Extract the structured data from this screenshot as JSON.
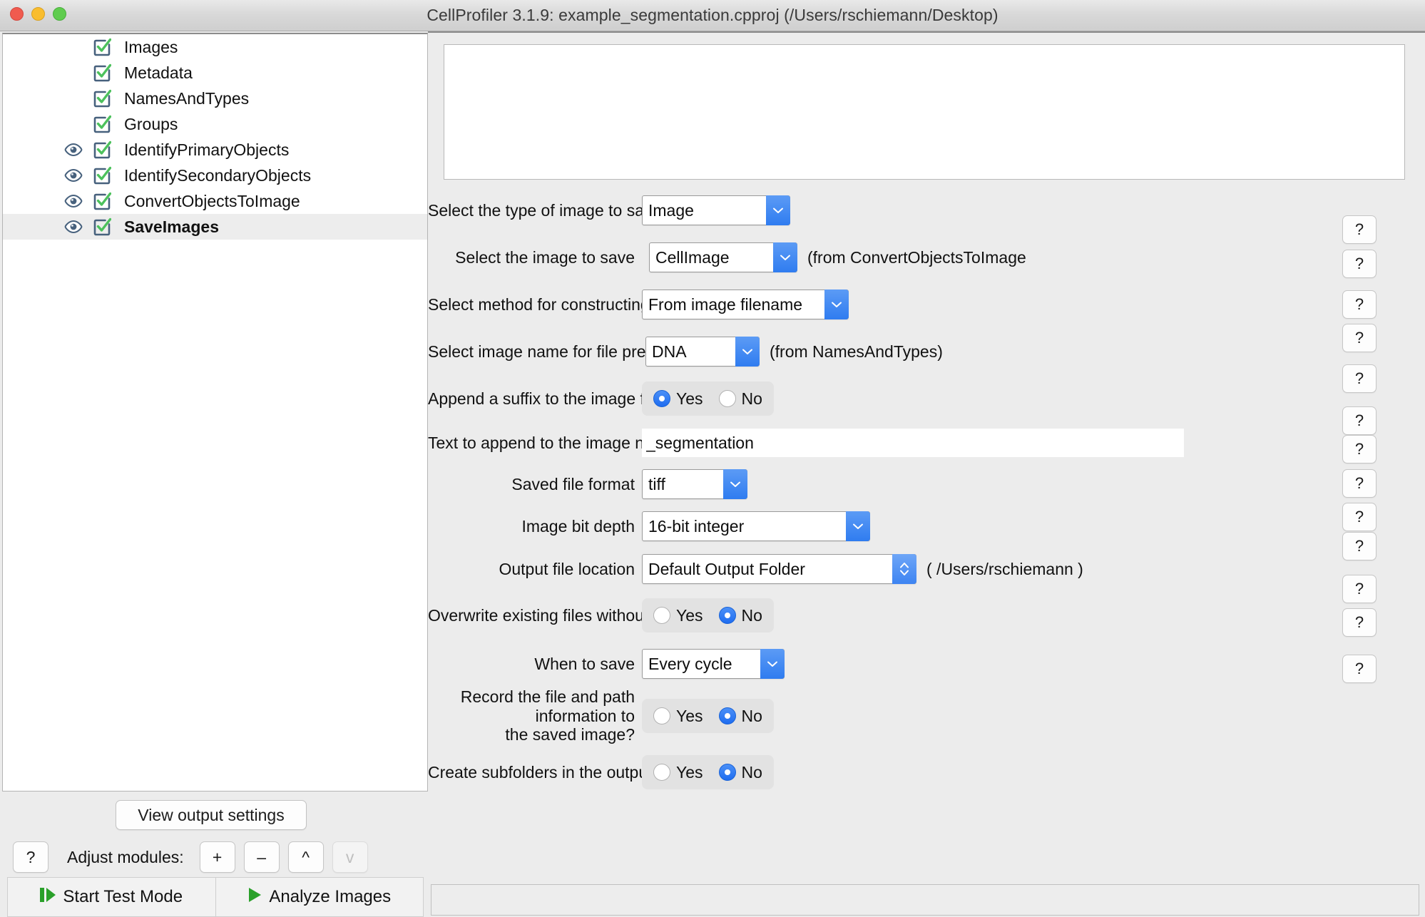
{
  "window": {
    "title": "CellProfiler 3.1.9: example_segmentation.cpproj (/Users/rschiemann/Desktop)",
    "traffic_lights": [
      "close",
      "minimize",
      "zoom"
    ]
  },
  "colors": {
    "accent_blue": "#2f7cf0",
    "radio_blue": "#1f6df0",
    "check_green": "#4cc15c",
    "check_outline": "#47617d",
    "panel_gray": "#ececec",
    "selection_gray": "#ededed",
    "run_green": "#2aa02a"
  },
  "pipeline": {
    "modules": [
      {
        "name": "Images",
        "enabled": true,
        "has_eye": false,
        "eye_on": false,
        "selected": false
      },
      {
        "name": "Metadata",
        "enabled": true,
        "has_eye": false,
        "eye_on": false,
        "selected": false
      },
      {
        "name": "NamesAndTypes",
        "enabled": true,
        "has_eye": false,
        "eye_on": false,
        "selected": false
      },
      {
        "name": "Groups",
        "enabled": true,
        "has_eye": false,
        "eye_on": false,
        "selected": false
      },
      {
        "name": "IdentifyPrimaryObjects",
        "enabled": true,
        "has_eye": true,
        "eye_on": true,
        "selected": false
      },
      {
        "name": "IdentifySecondaryObjects",
        "enabled": true,
        "has_eye": true,
        "eye_on": true,
        "selected": false
      },
      {
        "name": "ConvertObjectsToImage",
        "enabled": true,
        "has_eye": true,
        "eye_on": true,
        "selected": false
      },
      {
        "name": "SaveImages",
        "enabled": true,
        "has_eye": true,
        "eye_on": true,
        "selected": true
      }
    ]
  },
  "left_controls": {
    "view_output_settings": "View output settings",
    "help_button": "?",
    "adjust_modules_label": "Adjust modules:",
    "add_button": "+",
    "remove_button": "–",
    "move_up_button": "^",
    "move_down_button": "v",
    "move_down_enabled": false,
    "start_test_mode": "Start Test Mode",
    "analyze_images": "Analyze Images"
  },
  "notes": {
    "value": "",
    "placeholder": ""
  },
  "settings": {
    "help_label": "?",
    "rows": [
      {
        "label": "Select the type of image to save",
        "control": "combo",
        "value": "Image",
        "note": ""
      },
      {
        "label": "Select the image to save",
        "control": "combo",
        "value": "CellImage",
        "note": "(from ConvertObjectsToImage"
      },
      {
        "label": "Select method for constructing file names",
        "control": "combo",
        "value": "From image filename",
        "note": ""
      },
      {
        "label": "Select image name for file prefix",
        "control": "combo",
        "value": "DNA",
        "note": "(from NamesAndTypes)"
      },
      {
        "label": "Append a suffix to the image file name?",
        "control": "radio",
        "options": [
          "Yes",
          "No"
        ],
        "value": "Yes",
        "note": ""
      },
      {
        "label": "Text to append to the image name",
        "control": "text",
        "value": "_segmentation",
        "placeholder": "",
        "note": ""
      },
      {
        "label": "Saved file format",
        "control": "combo",
        "value": "tiff",
        "note": ""
      },
      {
        "label": "Image bit depth",
        "control": "combo",
        "value": "16-bit integer",
        "note": ""
      },
      {
        "label": "Output file location",
        "control": "stepper",
        "value": "Default Output Folder",
        "note": "( /Users/rschiemann )"
      },
      {
        "label": "Overwrite existing files without warning?",
        "control": "radio",
        "options": [
          "Yes",
          "No"
        ],
        "value": "No",
        "note": ""
      },
      {
        "label": "When to save",
        "control": "combo",
        "value": "Every cycle",
        "note": ""
      },
      {
        "label": "Record the file and path information to the saved image?",
        "label_line1": "Record the file and path information to",
        "label_line2": "the saved image?",
        "control": "radio",
        "options": [
          "Yes",
          "No"
        ],
        "value": "No",
        "note": ""
      },
      {
        "label": "Create subfolders in the output folder?",
        "control": "radio",
        "options": [
          "Yes",
          "No"
        ],
        "value": "No",
        "note": ""
      }
    ]
  },
  "statusbar": {
    "text": ""
  }
}
